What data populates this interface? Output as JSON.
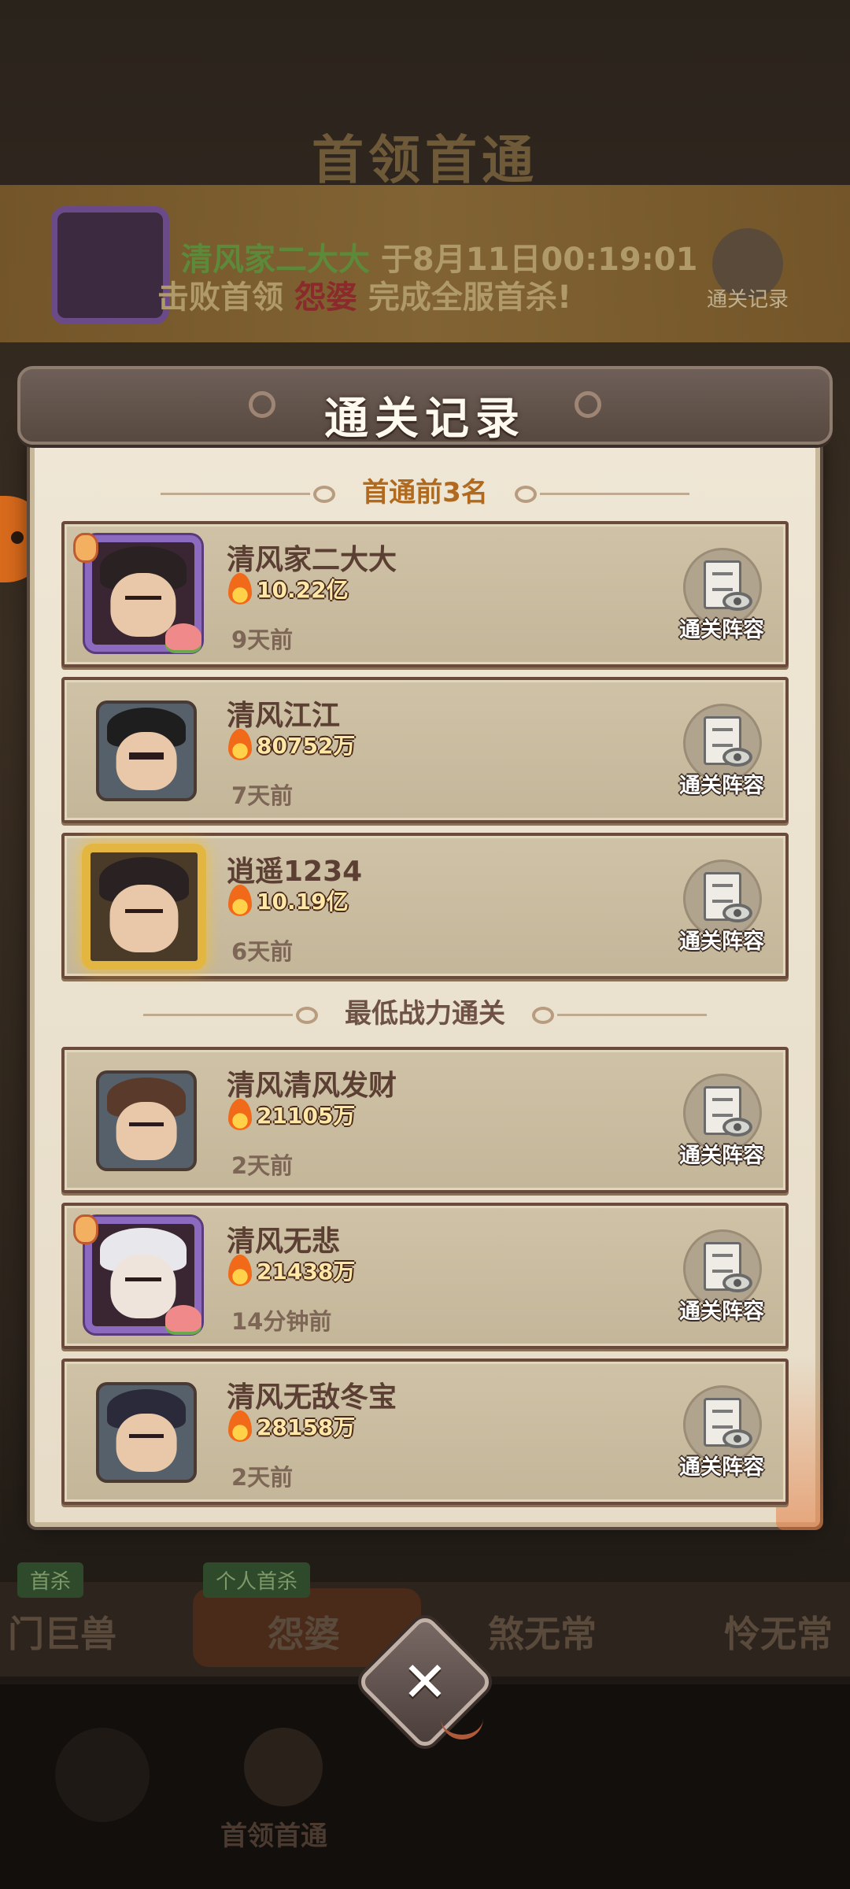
{
  "background": {
    "title": "首领首通",
    "banner": {
      "player": "清风家二大大",
      "time_text": "于8月11日00:19:01",
      "text_before_boss": "击败首领",
      "boss": "怨婆",
      "text_after_boss": "完成全服首杀!",
      "record_button": "通关记录"
    },
    "boss_tabs": [
      "门巨兽",
      "怨婆",
      "煞无常",
      "怜无常"
    ],
    "tags": [
      "首杀",
      "个人首杀"
    ],
    "nav_label": "首领首通"
  },
  "dialog": {
    "title": "通关记录",
    "section_top": "首通前3名",
    "section_lowest": "最低战力通关",
    "lineup_label": "通关阵容",
    "top3": [
      {
        "name": "清风家二大大",
        "power": "10.22亿",
        "time": "9天前",
        "frame": "purple"
      },
      {
        "name": "清风江江",
        "power": "80752万",
        "time": "7天前",
        "frame": "plain"
      },
      {
        "name": "逍遥1234",
        "power": "10.19亿",
        "time": "6天前",
        "frame": "gold"
      }
    ],
    "lowest": [
      {
        "name": "清风清风发财",
        "power": "21105万",
        "time": "2天前",
        "frame": "plain"
      },
      {
        "name": "清风无悲",
        "power": "21438万",
        "time": "14分钟前",
        "frame": "purple"
      },
      {
        "name": "清风无敌冬宝",
        "power": "28158万",
        "time": "2天前",
        "frame": "plain"
      }
    ]
  },
  "icons": {
    "close": "close-icon",
    "flame": "flame-icon",
    "lineup": "document-eye-icon"
  },
  "colors": {
    "dialog_bg": "#efe6d5",
    "card_bg": "#cfc2a6",
    "section_top": "#b06a20",
    "power_text": "#ffe7a8"
  }
}
